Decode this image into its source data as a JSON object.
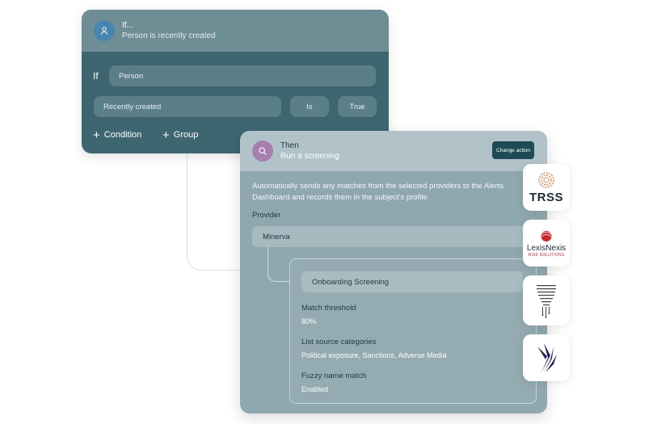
{
  "if_card": {
    "title": "If...",
    "subtitle": "Person is recently created",
    "if_label": "If",
    "entity": "Person",
    "condition_field": "Recently created",
    "operator": "Is",
    "value": "True",
    "add_condition_label": "Condition",
    "add_group_label": "Group"
  },
  "then_card": {
    "title": "Then",
    "subtitle": "Run a screening",
    "change_action_label": "Change action",
    "description": "Automatically sends any matches from the selected providers to the Alerts Dashboard and records them in the subject's profile",
    "provider_label": "Provider",
    "provider_value": "Minerva",
    "screening_name": "Onboarding Screening",
    "fields": {
      "match_threshold_label": "Match threshold",
      "match_threshold_value": "80%",
      "list_source_label": "List source categories",
      "list_source_value": "Political exposure, Sanctions, Adverse Media",
      "fuzzy_label": "Fuzzy name match",
      "fuzzy_value": "Enabled"
    }
  },
  "providers": {
    "trss": "TRSS",
    "lexis_name": "LexisNexis",
    "lexis_sub": "RISK SOLUTIONS"
  },
  "colors": {
    "if_body": "#3e6671",
    "then_body": "#8fa7ae",
    "accent_dark": "#1f4b57",
    "avatar_blue": "#4786b3",
    "avatar_purple": "#a67fae",
    "trss_orange": "#ea6a2a",
    "lexis_red": "#d0242b"
  },
  "icons": {
    "if_avatar": "person-icon",
    "then_avatar": "search-icon",
    "add": "plus-icon"
  }
}
